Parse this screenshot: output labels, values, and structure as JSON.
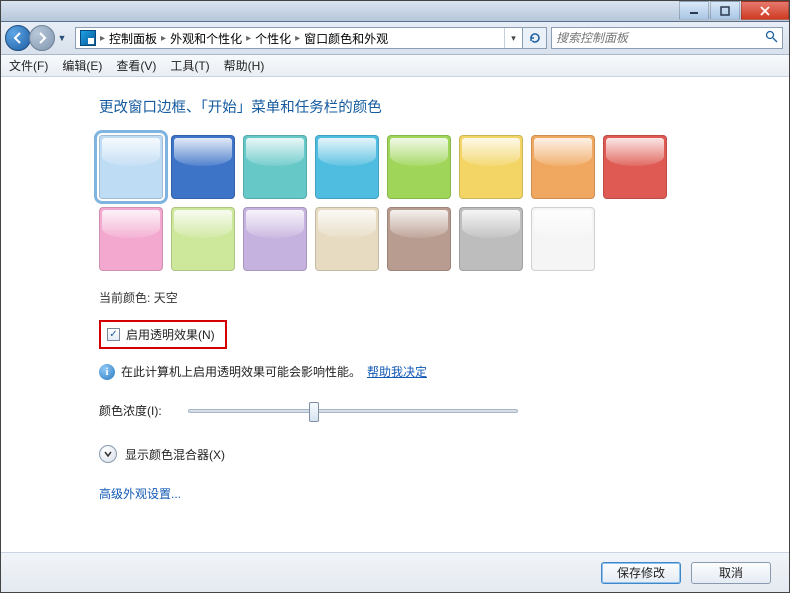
{
  "titlebar": {
    "left_text": ""
  },
  "breadcrumb": {
    "items": [
      "控制面板",
      "外观和个性化",
      "个性化",
      "窗口颜色和外观"
    ]
  },
  "search": {
    "placeholder": "搜索控制面板"
  },
  "menu": {
    "file": "文件(F)",
    "edit": "编辑(E)",
    "view": "查看(V)",
    "tools": "工具(T)",
    "help": "帮助(H)"
  },
  "main": {
    "heading": "更改窗口边框、「开始」菜单和任务栏的颜色",
    "swatches": [
      {
        "name": "sky",
        "color": "#bfdcf5",
        "selected": true
      },
      {
        "name": "blue",
        "color": "#3e74c8"
      },
      {
        "name": "teal",
        "color": "#67c8c8"
      },
      {
        "name": "cyan",
        "color": "#4fbde0"
      },
      {
        "name": "green",
        "color": "#9fd659"
      },
      {
        "name": "yellow",
        "color": "#f3d565"
      },
      {
        "name": "orange",
        "color": "#f0a860"
      },
      {
        "name": "red",
        "color": "#de5a52"
      },
      {
        "name": "pink",
        "color": "#f3a9cf"
      },
      {
        "name": "lime",
        "color": "#cde79b"
      },
      {
        "name": "lavender",
        "color": "#c6b2de"
      },
      {
        "name": "beige",
        "color": "#e7dbc2"
      },
      {
        "name": "brown",
        "color": "#b99c90"
      },
      {
        "name": "gray",
        "color": "#bdbdbd"
      },
      {
        "name": "white",
        "color": "#f5f5f5"
      }
    ],
    "current_label": "当前颜色:",
    "current_value": "天空",
    "transparency_label": "启用透明效果(N)",
    "transparency_checked": true,
    "info_text": "在此计算机上启用透明效果可能会影响性能。",
    "info_link": "帮助我决定",
    "intensity_label": "颜色浓度(I):",
    "intensity_value": 0.38,
    "mixer_label": "显示颜色混合器(X)",
    "advanced_link": "高级外观设置..."
  },
  "footer": {
    "save": "保存修改",
    "cancel": "取消"
  }
}
